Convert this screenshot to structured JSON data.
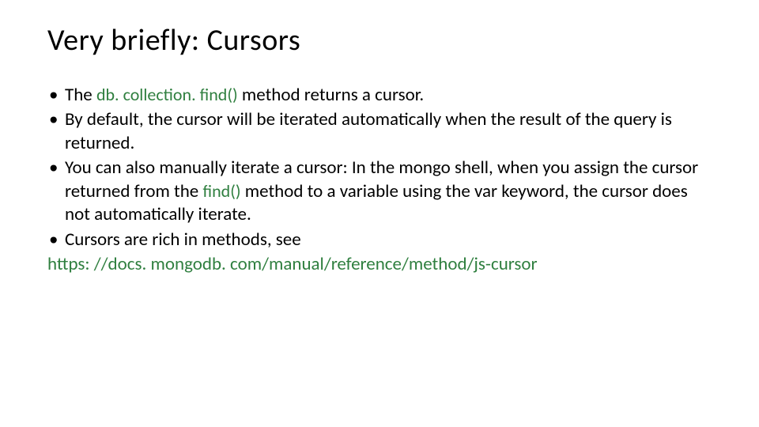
{
  "slide": {
    "title": "Very briefly: Cursors",
    "bullets": [
      {
        "pre": "The ",
        "code": "db. collection. find()",
        "post": " method returns a cursor."
      },
      {
        "text": "By default, the cursor will be iterated automatically when the result of the query is returned."
      },
      {
        "pre": "You can also manually iterate a cursor: In the mongo shell, when you assign the cursor returned from the ",
        "code": "find()",
        "post": " method to a variable using the var keyword, the cursor does not automatically iterate."
      },
      {
        "text": "Cursors are rich in methods, see"
      }
    ],
    "link": "https: //docs. mongodb. com/manual/reference/method/js-cursor"
  }
}
